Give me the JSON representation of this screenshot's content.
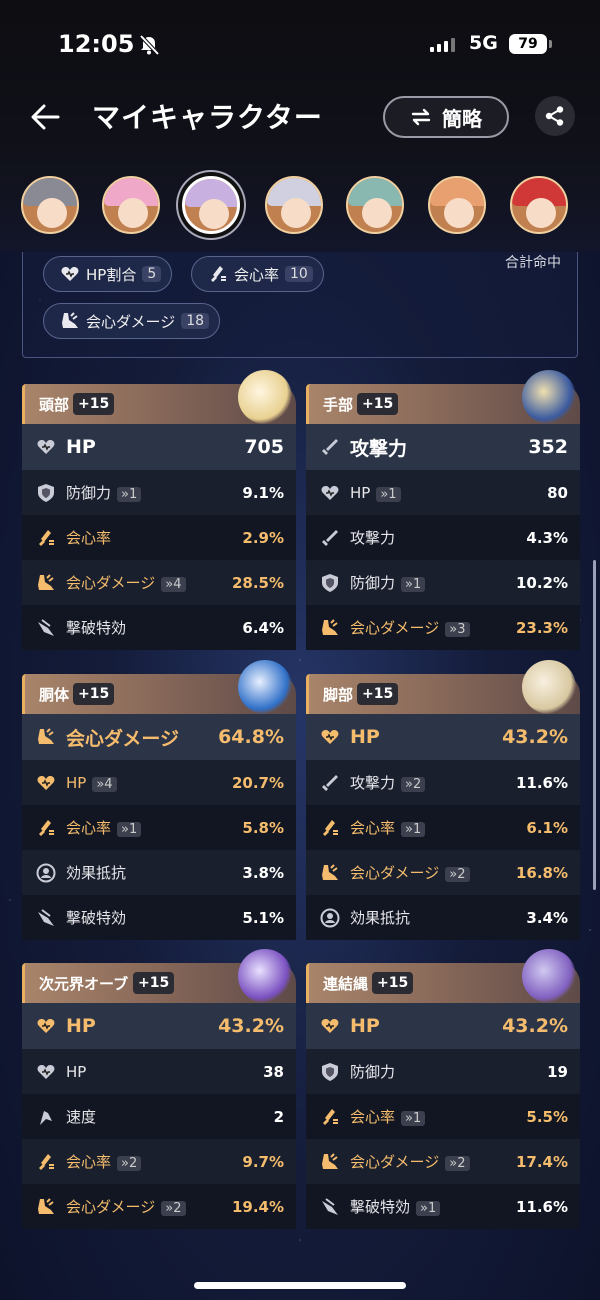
{
  "status": {
    "time": "12:05",
    "network": "5G",
    "battery": "79"
  },
  "header": {
    "title": "マイキャラクター",
    "brief_label": "簡略"
  },
  "avatars": [
    {
      "hair": "#8a8a94"
    },
    {
      "hair": "#f0a8c8"
    },
    {
      "hair": "#c8b0e0",
      "selected": true
    },
    {
      "hair": "#d0d0e0"
    },
    {
      "hair": "#88b8b0"
    },
    {
      "hair": "#e8a070"
    },
    {
      "hair": "#d03838"
    }
  ],
  "summary": {
    "total_label": "合計命中",
    "pills": [
      {
        "label": "HP割合",
        "count": "5",
        "icon": "hp-icon"
      },
      {
        "label": "会心率",
        "count": "10",
        "icon": "crit-rate-icon"
      },
      {
        "label": "会心ダメージ",
        "count": "18",
        "icon": "crit-dmg-icon"
      }
    ]
  },
  "relics": [
    {
      "slot": "頭部",
      "level": "+15",
      "main": {
        "name": "HP",
        "value": "705",
        "icon": "hp-icon",
        "gold": false
      },
      "subs": [
        {
          "name": "防御力",
          "up": "»1",
          "value": "9.1%",
          "icon": "def-icon",
          "gold": false
        },
        {
          "name": "会心率",
          "up": "",
          "value": "2.9%",
          "icon": "crit-rate-icon",
          "gold": true
        },
        {
          "name": "会心ダメージ",
          "up": "»4",
          "value": "28.5%",
          "icon": "crit-dmg-icon",
          "gold": true
        },
        {
          "name": "撃破特効",
          "up": "",
          "value": "6.4%",
          "icon": "break-icon",
          "gold": false
        }
      ]
    },
    {
      "slot": "手部",
      "level": "+15",
      "main": {
        "name": "攻撃力",
        "value": "352",
        "icon": "atk-icon",
        "gold": false
      },
      "subs": [
        {
          "name": "HP",
          "up": "»1",
          "value": "80",
          "icon": "hp-icon",
          "gold": false
        },
        {
          "name": "攻撃力",
          "up": "",
          "value": "4.3%",
          "icon": "atk-icon",
          "gold": false
        },
        {
          "name": "防御力",
          "up": "»1",
          "value": "10.2%",
          "icon": "def-icon",
          "gold": false
        },
        {
          "name": "会心ダメージ",
          "up": "»3",
          "value": "23.3%",
          "icon": "crit-dmg-icon",
          "gold": true
        }
      ]
    },
    {
      "slot": "胴体",
      "level": "+15",
      "main": {
        "name": "会心ダメージ",
        "value": "64.8%",
        "icon": "crit-dmg-icon",
        "gold": true
      },
      "subs": [
        {
          "name": "HP",
          "up": "»4",
          "value": "20.7%",
          "icon": "hp-icon",
          "gold": true
        },
        {
          "name": "会心率",
          "up": "»1",
          "value": "5.8%",
          "icon": "crit-rate-icon",
          "gold": true
        },
        {
          "name": "効果抵抗",
          "up": "",
          "value": "3.8%",
          "icon": "effect-res-icon",
          "gold": false
        },
        {
          "name": "撃破特効",
          "up": "",
          "value": "5.1%",
          "icon": "break-icon",
          "gold": false
        }
      ]
    },
    {
      "slot": "脚部",
      "level": "+15",
      "main": {
        "name": "HP",
        "value": "43.2%",
        "icon": "hp-icon",
        "gold": true
      },
      "subs": [
        {
          "name": "攻撃力",
          "up": "»2",
          "value": "11.6%",
          "icon": "atk-icon",
          "gold": false
        },
        {
          "name": "会心率",
          "up": "»1",
          "value": "6.1%",
          "icon": "crit-rate-icon",
          "gold": true
        },
        {
          "name": "会心ダメージ",
          "up": "»2",
          "value": "16.8%",
          "icon": "crit-dmg-icon",
          "gold": true
        },
        {
          "name": "効果抵抗",
          "up": "",
          "value": "3.4%",
          "icon": "effect-res-icon",
          "gold": false
        }
      ]
    },
    {
      "slot": "次元界オーブ",
      "level": "+15",
      "main": {
        "name": "HP",
        "value": "43.2%",
        "icon": "hp-icon",
        "gold": true
      },
      "subs": [
        {
          "name": "HP",
          "up": "",
          "value": "38",
          "icon": "hp-icon",
          "gold": false
        },
        {
          "name": "速度",
          "up": "",
          "value": "2",
          "icon": "speed-icon",
          "gold": false
        },
        {
          "name": "会心率",
          "up": "»2",
          "value": "9.7%",
          "icon": "crit-rate-icon",
          "gold": true
        },
        {
          "name": "会心ダメージ",
          "up": "»2",
          "value": "19.4%",
          "icon": "crit-dmg-icon",
          "gold": true
        }
      ]
    },
    {
      "slot": "連結縄",
      "level": "+15",
      "main": {
        "name": "HP",
        "value": "43.2%",
        "icon": "hp-icon",
        "gold": true
      },
      "subs": [
        {
          "name": "防御力",
          "up": "",
          "value": "19",
          "icon": "def-icon",
          "gold": false
        },
        {
          "name": "会心率",
          "up": "»1",
          "value": "5.5%",
          "icon": "crit-rate-icon",
          "gold": true
        },
        {
          "name": "会心ダメージ",
          "up": "»2",
          "value": "17.4%",
          "icon": "crit-dmg-icon",
          "gold": true
        },
        {
          "name": "撃破特効",
          "up": "»1",
          "value": "11.6%",
          "icon": "break-icon",
          "gold": false
        }
      ]
    }
  ]
}
